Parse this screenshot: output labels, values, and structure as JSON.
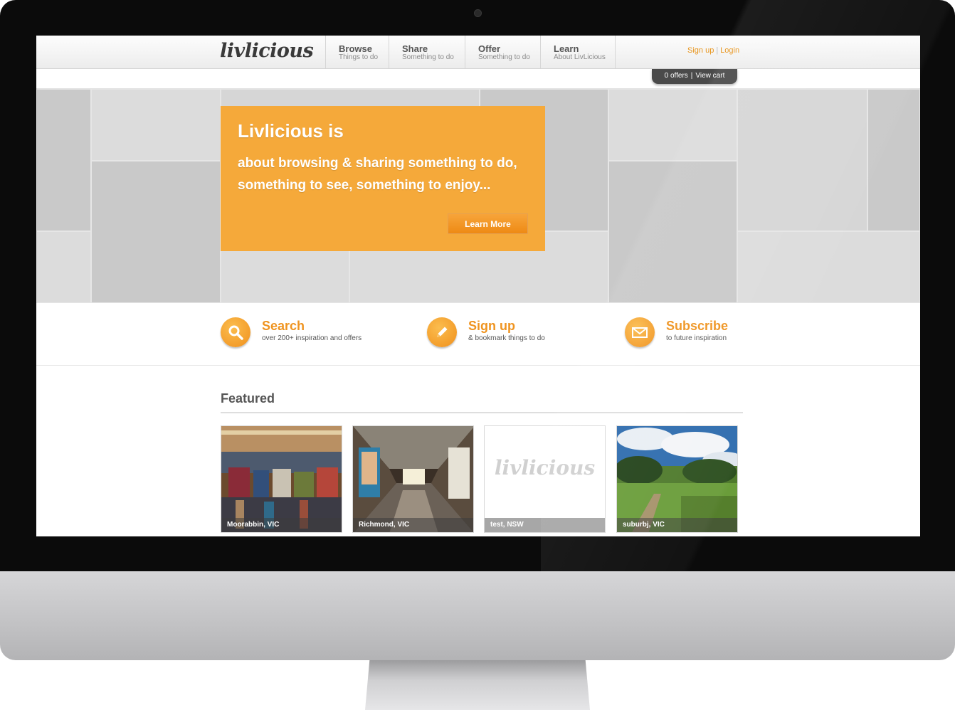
{
  "brand": {
    "logo_text": "livlicious"
  },
  "nav": {
    "items": [
      {
        "title": "Browse",
        "subtitle": "Things to do"
      },
      {
        "title": "Share",
        "subtitle": "Something to do"
      },
      {
        "title": "Offer",
        "subtitle": "Something to do"
      },
      {
        "title": "Learn",
        "subtitle": "About LivLicious"
      }
    ],
    "signup_label": "Sign up",
    "separator": "|",
    "login_label": "Login"
  },
  "cart": {
    "offers_text": "0 offers",
    "separator": "|",
    "view_cart_label": "View cart"
  },
  "hero": {
    "title": "Livlicious is",
    "text_line1": "about browsing & sharing something to do,",
    "text_line2": "something to see, something to enjoy...",
    "cta_label": "Learn More",
    "panel_color": "#f5a93a"
  },
  "features": [
    {
      "icon": "search-icon",
      "title": "Search",
      "subtitle": "over 200+ inspiration and offers"
    },
    {
      "icon": "pencil-icon",
      "title": "Sign up",
      "subtitle": "& bookmark things to do"
    },
    {
      "icon": "envelope-icon",
      "title": "Subscribe",
      "subtitle": "to future inspiration"
    }
  ],
  "featured": {
    "heading": "Featured",
    "cards": [
      {
        "label": "Moorabbin, VIC",
        "image": "market-stalls-photo"
      },
      {
        "label": "Richmond, VIC",
        "image": "subway-tunnel-photo"
      },
      {
        "label": "test, NSW",
        "image": "livlicious-placeholder-logo",
        "logo_text": "livlicious"
      },
      {
        "label": "suburbj, VIC",
        "image": "grassy-path-photo"
      }
    ]
  },
  "colors": {
    "accent": "#ef9420",
    "nav_text": "#555555",
    "cart_bg": "#4a4a4a"
  }
}
